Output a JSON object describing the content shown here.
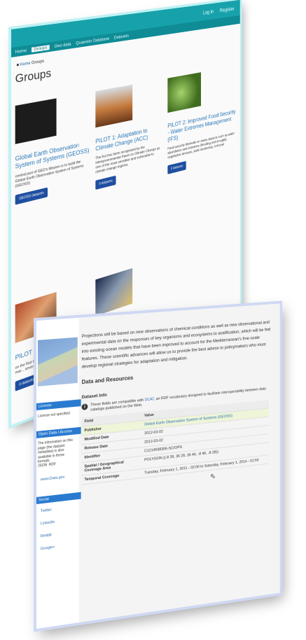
{
  "back": {
    "topbar": {
      "login": "Log in",
      "register": "Register"
    },
    "nav": [
      "Home",
      "Groups",
      "Geo data",
      "Quaestor Database",
      "Datasets"
    ],
    "breadcrumb": {
      "home": "Home",
      "current": "Groups"
    },
    "title": "Groups",
    "cards": [
      {
        "title": "Global Earth Observation System of Systems (GEOSS)",
        "desc": "central part of GEO's Mission is to build the Global Earth Observation System of Systems (GEOSS)",
        "button": "GEOSS datasets",
        "color": "#2a2a2a"
      },
      {
        "title": "PILOT 1: Adaptation to Climate Change (ACC)",
        "desc": "The Ksi has been recognised by the Intergovernmental Panel on Climate Change as one of the most sensitive and vulnerable to climate change regions.",
        "button": "0 datasets",
        "color": "#b06a38"
      },
      {
        "title": "PILOT 2: Improved Food Security - Water Extremes Management (IFS)",
        "desc": "Food security depends on many aspects such as water abundance and extremes (flooding and drought), vegetation stresses, yield monitoring, soil qual",
        "button": "0 datasets",
        "color": "#5d8a2c"
      },
      {
        "title": "PILOT 3: Ac... (RM)",
        "desc": "on the first time available in the... monitoring, mar... several respon...",
        "button": "0 datasets",
        "color": "#8a5a3a"
      },
      {
        "title": "",
        "desc": "",
        "button": "",
        "color": "#3a4a6a"
      }
    ]
  },
  "front": {
    "sidebar": {
      "license_head": "License",
      "license_text": "License not specified",
      "open_head": "Open Data / Access",
      "open_text": "The information on this page (the dataset metadata) is also available in these formats.",
      "formats": [
        "JSON",
        "RDF"
      ],
      "opendata": "www.Data.gov",
      "social_head": "Social",
      "social": [
        "Twitter",
        "LinkedIn",
        "Reddit",
        "Google+"
      ]
    },
    "intro": "Projections will be based on new observations of chemical conditions as well as new observational and experimental data on the responses of key organisms and ecosystems to acidification, which will be fed into existing ocean models that have been improved to account for the Mediterranean's fine-scale features. These scientific advances will allow us to provide the best advice to policymakers who must develop regional strategies for adaptation and mitigation.",
    "resources_title": "Data and Resources",
    "dataset_info_title": "Dataset Info",
    "info_note_pre": "These fields are compatible with ",
    "info_note_link": "DCAT",
    "info_note_post": ", an RDF vocabulary designed to facilitate interoperability between data catalogs published on the Web.",
    "table": {
      "headers": [
        "Field",
        "Value"
      ],
      "rows": [
        {
          "field": "Publisher",
          "value": "Global Earth Observation System of Systems (GEOSS)",
          "link": true
        },
        {
          "field": "Modified Date",
          "value": "2012-03-02"
        },
        {
          "field": "Release Date",
          "value": "2012-03-02"
        },
        {
          "field": "Identifier",
          "value": "C1214598306-SCIOPS"
        },
        {
          "field": "Spatial / Geographical Coverage Area",
          "value": "POLYGON ((-8 28, 36 28, 36 46, -8 46, -8 28))"
        },
        {
          "field": "Temporal Coverage",
          "value": "Tuesday, February 1, 2011 - 02:00 to Saturday, February 1, 2014 - 01:59"
        }
      ]
    }
  }
}
